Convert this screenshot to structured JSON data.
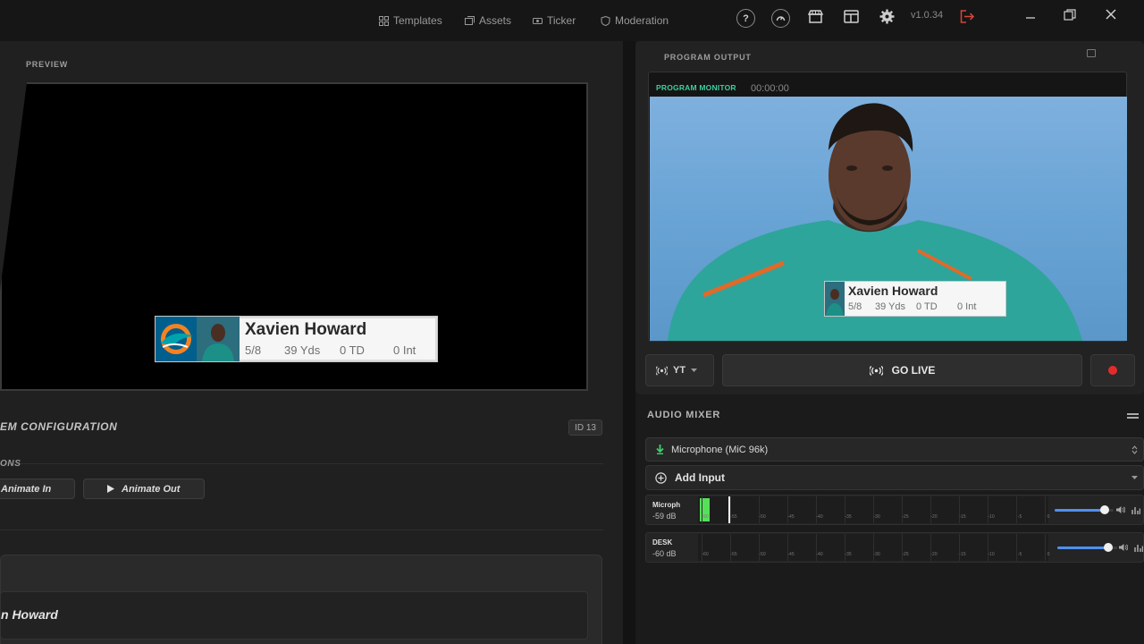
{
  "topbar": {
    "nav": [
      {
        "label": "Templates",
        "icon": "templates-icon"
      },
      {
        "label": "Assets",
        "icon": "assets-icon"
      },
      {
        "label": "Ticker",
        "icon": "ticker-icon"
      },
      {
        "label": "Moderation",
        "icon": "moderation-icon"
      }
    ],
    "help_glyph": "?",
    "version": "v1.0.34"
  },
  "preview": {
    "label": "PREVIEW",
    "lower_third": {
      "name": "Xavien Howard",
      "stats": [
        "5/8",
        "39 Yds",
        "0 TD",
        "0 Int"
      ]
    }
  },
  "config": {
    "title": "EM CONFIGURATION",
    "id_badge": "ID 13",
    "actions_label": "ONS",
    "animate_in": "Animate In",
    "animate_out": "Animate Out",
    "name_value": "n Howard"
  },
  "program": {
    "label": "PROGRAM OUTPUT",
    "monitor_label": "PROGRAM MONITOR",
    "timecode": "00:00:00",
    "lower_third": {
      "name": "Xavien Howard",
      "stats": [
        "5/8",
        "39 Yds",
        "0 TD",
        "0 Int"
      ]
    },
    "platform": "YT",
    "go_live": "GO LIVE"
  },
  "audio": {
    "label": "AUDIO MIXER",
    "device": "Microphone (MiC 96k)",
    "add_input": "Add Input",
    "scale": [
      "-60",
      "-55",
      "-50",
      "-45",
      "-40",
      "-35",
      "-30",
      "-25",
      "-20",
      "-15",
      "-10",
      "-5",
      "0"
    ],
    "channels": [
      {
        "name": "Microph",
        "db": "-59 dB",
        "volume": 0.85
      },
      {
        "name": "DESK",
        "db": "-60 dB",
        "volume": 0.85
      }
    ]
  },
  "colors": {
    "accent_green": "#3ccfa0",
    "meter_green": "#56e05a",
    "record_red": "#e52a2a",
    "slider_blue": "#4f8ff0",
    "logout_red": "#d9443a"
  }
}
